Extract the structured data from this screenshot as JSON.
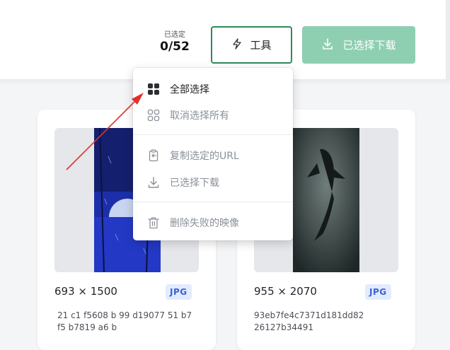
{
  "header": {
    "selected_caption": "已选定",
    "selected_count": "0/52",
    "tools_label": "工具",
    "download_label": "已选择下载",
    "accent_color": "#2e8b57",
    "download_bg": "#8ecfb1"
  },
  "menu": {
    "items": [
      {
        "label": "全部选择",
        "icon": "grid-filled-icon",
        "enabled": true
      },
      {
        "label": "取消选择所有",
        "icon": "grid-outline-icon",
        "enabled": false
      },
      {
        "label": "复制选定的URL",
        "icon": "copy-url-icon",
        "enabled": false
      },
      {
        "label": "已选择下载",
        "icon": "download-icon",
        "enabled": false
      },
      {
        "label": "删除失败的映像",
        "icon": "trash-icon",
        "enabled": false
      }
    ]
  },
  "cards": [
    {
      "dimensions": "693 × 1500",
      "format": "JPG",
      "hash": "21 c1 f5608 b 99 d19077 51 b7 f5 b7819 a6 b"
    },
    {
      "dimensions": "955 × 2070",
      "format": "JPG",
      "hash": "93eb7fe4c7371d181dd82 26127b34491"
    }
  ],
  "colors": {
    "badge_bg": "#e3ebff",
    "badge_text": "#3a62d8",
    "annotation_arrow": "#e0312b"
  }
}
